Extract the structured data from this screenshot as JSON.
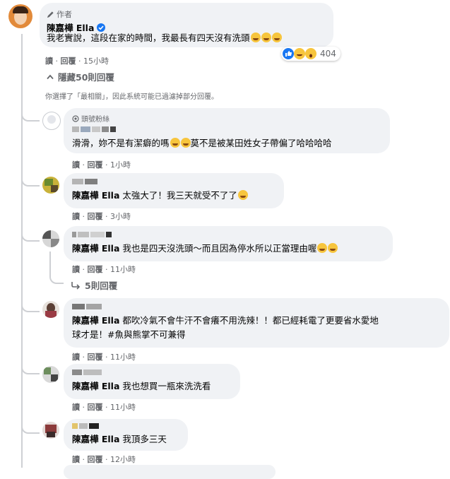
{
  "author_comment": {
    "badge_label": "作者",
    "name": "陳嘉樺 Ella",
    "text": "我老實說，這段在家的時間，我最長有四天沒有洗頭",
    "reaction_count": "404",
    "actions": {
      "read": "讀",
      "reply": "回覆",
      "time": "15小時"
    }
  },
  "hidden_replies_label": "隱藏50則回覆",
  "filter_notice": "你選擇了「最相關」，因此系統可能已過濾掉部分回覆。",
  "replies": [
    {
      "badge_label": "頭號粉絲",
      "mention": "",
      "text": "滑滑，妳不是有潔癖的嗎",
      "text_tail": "莫不是被某田姓女子帶偏了哈哈哈哈",
      "actions": {
        "read": "讀",
        "reply": "回覆",
        "time": "1小時"
      }
    },
    {
      "mention": "陳嘉樺 Ella",
      "text": " 太強大了！我三天就受不了了",
      "actions": {
        "read": "讀",
        "reply": "回覆",
        "time": "3小時"
      }
    },
    {
      "mention": "陳嘉樺 Ella",
      "text": " 我也是四天沒洗頭～而且因為停水所以正當理由喔",
      "actions": {
        "read": "讀",
        "reply": "回覆",
        "time": "11小時"
      },
      "sub_replies_label": "5則回覆"
    },
    {
      "mention": "陳嘉樺 Ella",
      "text": " 都吹冷氣不會牛汗不會癢不用洗辣！！都已經耗電了更要省水愛地",
      "text_line2": "球才是！#魚與熊掌不可兼得",
      "actions": {
        "read": "讀",
        "reply": "回覆",
        "time": "11小時"
      }
    },
    {
      "mention": "陳嘉樺 Ella",
      "text": " 我也想買一瓶來洗洗看",
      "actions": {
        "read": "讀",
        "reply": "回覆",
        "time": "11小時"
      }
    },
    {
      "mention": "陳嘉樺 Ella",
      "text": " 我頂多三天",
      "actions": {
        "read": "讀",
        "reply": "回覆",
        "time": "12小時"
      }
    }
  ],
  "colors": {
    "link_blue": "#1877f2",
    "bubble": "#f0f2f5",
    "meta": "#65676b"
  },
  "icons": [
    "pen-icon",
    "verified-badge-icon",
    "like-reaction-icon",
    "haha-reaction-icon",
    "wow-reaction-icon",
    "chevron-up-icon",
    "reply-arrow-icon"
  ]
}
